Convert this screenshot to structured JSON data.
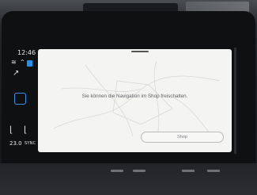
{
  "status_bar": {
    "time": "12:46",
    "temperature": "23.0",
    "sync_label": "SYNC"
  },
  "popup": {
    "message": "Sie können die Navigation im Shop freischalten.",
    "shop_button_label": "Shop"
  },
  "colors": {
    "accent": "#2f8de0",
    "panel_background": "#f4f4f2",
    "text": "#5d5f62"
  },
  "icons": [
    "wifi-icon",
    "signal-icon",
    "arrow-icon",
    "seat-heat-left-icon",
    "seat-heat-right-icon"
  ]
}
